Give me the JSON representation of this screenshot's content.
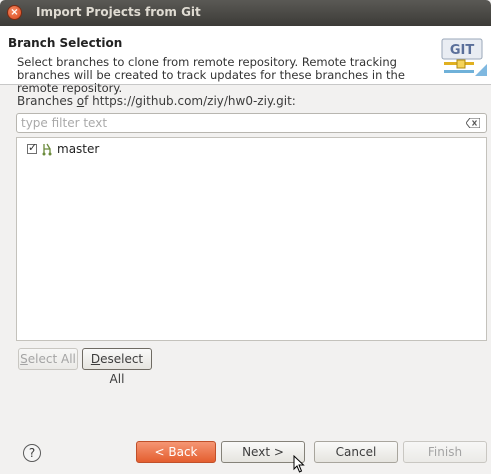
{
  "window": {
    "title": "Import Projects from Git",
    "close_glyph": "×"
  },
  "banner": {
    "title": "Branch Selection",
    "description": "Select branches to clone from remote repository. Remote tracking branches will be created to track updates for these branches in the remote repository.",
    "logo_text": "GIT"
  },
  "branches": {
    "label_prefix": "Branches ",
    "label_mnemonic": "o",
    "label_rest": "f https://github.com/ziy/hw0-ziy.git:",
    "filter_placeholder": "type filter text",
    "items": [
      {
        "label": "master",
        "checked": true,
        "icon": "branch-icon"
      }
    ]
  },
  "selection_buttons": {
    "select_all_mnemonic": "S",
    "select_all_rest": "elect All",
    "deselect_all_mnemonic": "D",
    "deselect_all_rest": "eselect All"
  },
  "footer": {
    "help_glyph": "?",
    "back_label": "< Back",
    "next_label": "Next >",
    "cancel_label": "Cancel",
    "finish_label": "Finish"
  },
  "colors": {
    "back_button": "#e45e2f",
    "titlebar": "#3c3b37"
  }
}
